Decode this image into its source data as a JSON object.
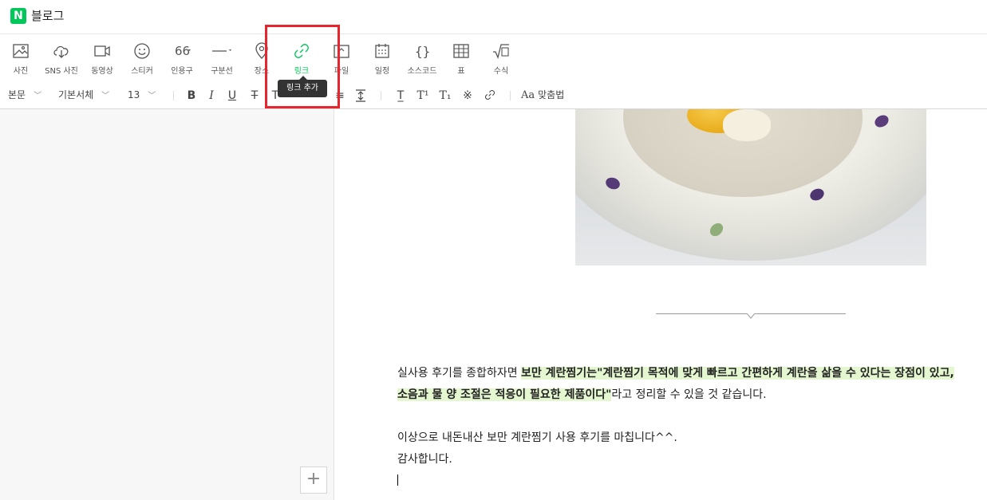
{
  "app": {
    "logo_letter": "N",
    "title": "블로그"
  },
  "toolbar": {
    "items": [
      {
        "label": "사진",
        "icon": "photo-icon"
      },
      {
        "label": "SNS 사진",
        "icon": "cloud-download-icon"
      },
      {
        "label": "동영상",
        "icon": "video-icon"
      },
      {
        "label": "스티커",
        "icon": "smiley-icon"
      },
      {
        "label": "인용구",
        "icon": "quote-icon"
      },
      {
        "label": "구분선",
        "icon": "horizontal-line-icon"
      },
      {
        "label": "장소",
        "icon": "map-pin-icon"
      },
      {
        "label": "링크",
        "icon": "link-icon"
      },
      {
        "label": "파일",
        "icon": "file-icon"
      },
      {
        "label": "일정",
        "icon": "calendar-icon"
      },
      {
        "label": "소스코드",
        "icon": "code-braces-icon"
      },
      {
        "label": "표",
        "icon": "table-icon"
      },
      {
        "label": "수식",
        "icon": "formula-icon"
      }
    ],
    "active_item": "링크",
    "tooltip": "링크 추가"
  },
  "format": {
    "paragraph_style": "본문",
    "font_family": "기본서체",
    "font_size": "13",
    "align_label": "맞춤법"
  },
  "colors": {
    "accent": "#03c75a",
    "highlight": "#e4f7d0",
    "annotation": "#e8242c"
  },
  "content": {
    "line1_normal": "실사용 후기를 종합하자면 ",
    "line1_highlight": "보만 계란찜기는\"계란찜기 목적에 맞게 빠르고 간편하게 계란을 삶을 수 있다는 장점이 있고,",
    "line2_highlight": "소음과 물 양 조절은 적응이 필요한 제품이다\"",
    "line2_normal": "라고 정리할 수 있을 것 같습니다.",
    "line3": "이상으로 내돈내산 보만 계란찜기 사용 후기를 마칩니다^^.",
    "line4": "감사합니다."
  }
}
